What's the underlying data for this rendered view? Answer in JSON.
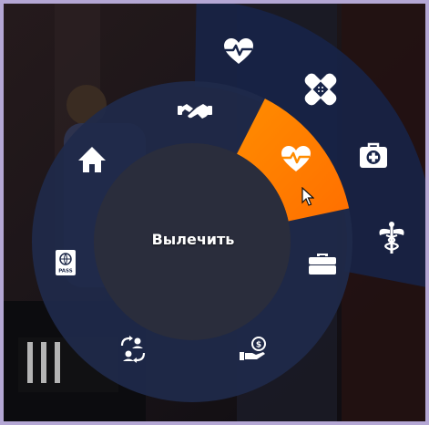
{
  "radial_menu": {
    "center_label": "Вылечить",
    "colors": {
      "ring": "#1f2a4a",
      "ring_opacity": 0.93,
      "center": "#2a2d3c",
      "submenu": "#172449",
      "submenu_opacity": 0.86,
      "active": "#ff8c00",
      "active_gradient_end": "#ff6f00",
      "icon": "#ffffff"
    },
    "main_items": [
      {
        "id": "handshake",
        "icon": "handshake-icon"
      },
      {
        "id": "heal",
        "icon": "heart-pulse-icon",
        "active": true
      },
      {
        "id": "briefcase",
        "icon": "briefcase-icon"
      },
      {
        "id": "money",
        "icon": "money-hand-icon"
      },
      {
        "id": "exchange",
        "icon": "user-exchange-icon"
      },
      {
        "id": "passport",
        "icon": "passport-icon",
        "text": "PASS"
      },
      {
        "id": "home",
        "icon": "home-icon"
      }
    ],
    "sub_items": [
      {
        "id": "heart",
        "icon": "heart-pulse-icon"
      },
      {
        "id": "bandage",
        "icon": "bandage-icon"
      },
      {
        "id": "medkit",
        "icon": "medkit-icon"
      },
      {
        "id": "caduceus",
        "icon": "caduceus-icon"
      }
    ]
  }
}
